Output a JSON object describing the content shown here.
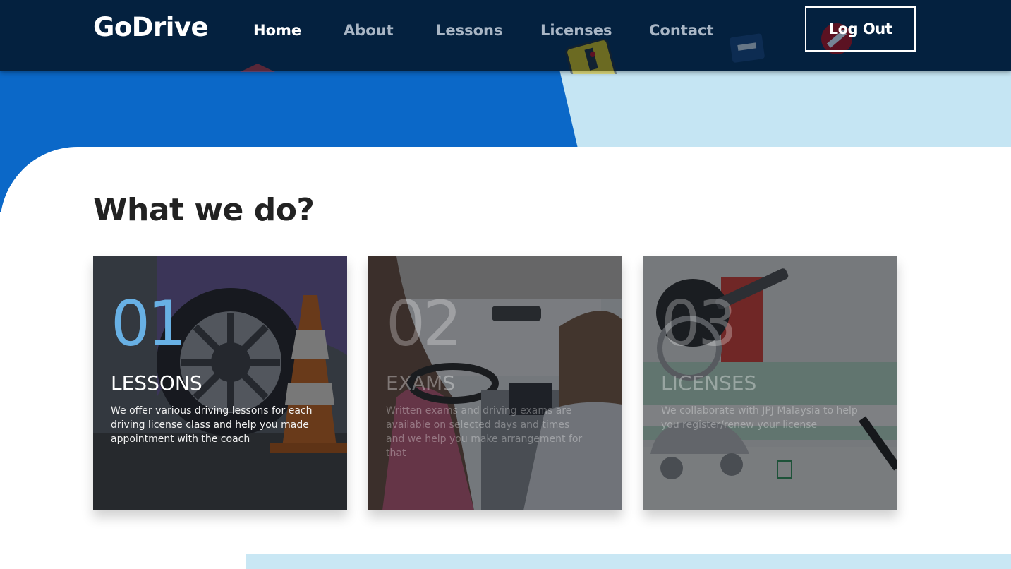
{
  "brand": {
    "name": "GoDrive"
  },
  "nav": {
    "items": [
      {
        "label": "Home",
        "active": true
      },
      {
        "label": "About",
        "active": false
      },
      {
        "label": "Lessons",
        "active": false
      },
      {
        "label": "Licenses",
        "active": false
      },
      {
        "label": "Contact",
        "active": false
      }
    ],
    "logout_label": "Log Out"
  },
  "section": {
    "title": "What we do?",
    "cards": [
      {
        "number": "01",
        "title": "LESSONS",
        "description": "We offer various driving lessons for each driving license class and help you made appointment with the coach",
        "image": "car-wheel-traffic-cone-photo"
      },
      {
        "number": "02",
        "title": "EXAMS",
        "description": "Written exams and driving exams are available on selected days and times and we help you make arrangement for that",
        "image": "driving-instructor-in-car-photo"
      },
      {
        "number": "03",
        "title": "LICENSES",
        "description": "We collaborate with JPJ Malaysia to help you register/renew your license",
        "image": "car-keys-license-form-photo"
      }
    ]
  },
  "colors": {
    "navbar": "#04213f",
    "hero_blue": "#0b68c8",
    "hero_light": "#c5e5f3",
    "accent_number": "#68b0e4",
    "title_text": "#222222"
  }
}
